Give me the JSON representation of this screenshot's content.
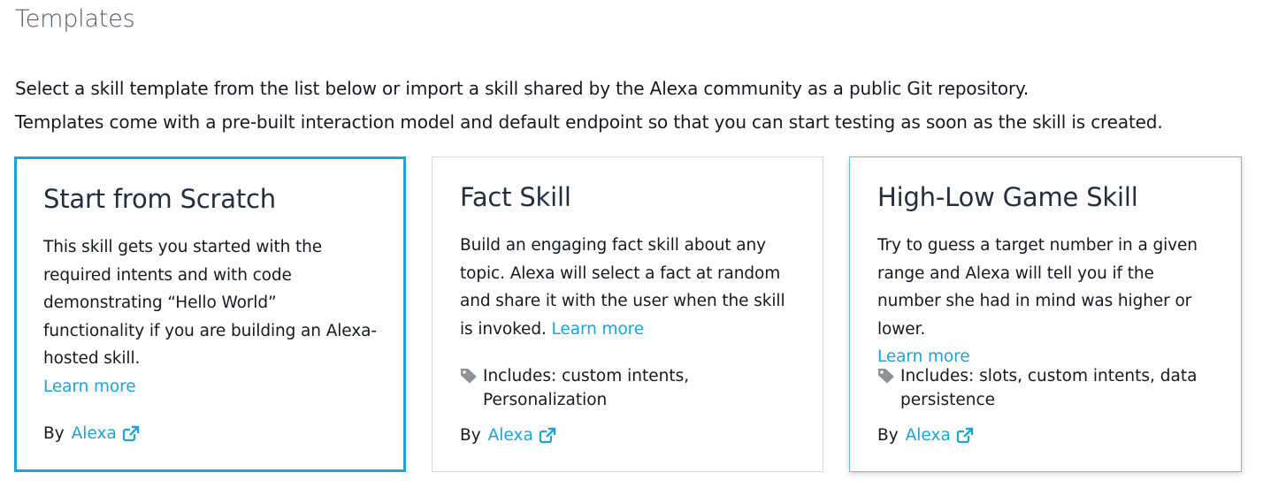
{
  "page": {
    "title": "Templates",
    "description_line1": "Select a skill template from the list below or import a skill shared by the Alexa community as a public Git repository.",
    "description_line2": "Templates come with a pre-built interaction model and default endpoint so that you can start testing as soon as the skill is created."
  },
  "cards": [
    {
      "title": "Start from Scratch",
      "body": "This skill gets you started with the required intents and with code demonstrating “Hello World” functionality if you are building an Alexa-hosted skill.",
      "learn_more": "Learn more",
      "includes": "",
      "by_label": "By",
      "author": "Alexa",
      "selected": true
    },
    {
      "title": "Fact Skill",
      "body": "Build an engaging fact skill about any topic. Alexa will select a fact at random and share it with the user when the skill is invoked.",
      "learn_more": "Learn more",
      "includes": "Includes: custom intents, Personalization",
      "by_label": "By",
      "author": "Alexa",
      "selected": false
    },
    {
      "title": "High-Low Game Skill",
      "body": "Try to guess a target number in a given range and Alexa will tell you if the number she had in mind was higher or lower.",
      "learn_more": "Learn more",
      "includes": "Includes: slots, custom intents, data persistence",
      "by_label": "By",
      "author": "Alexa",
      "selected": false
    }
  ],
  "icons": {
    "tag": "tag-icon",
    "external_link": "external-link-icon"
  },
  "colors": {
    "link": "#1ba4d8",
    "selected_border": "#1ba4d8",
    "hover_border": "#5bc8dd",
    "card_border": "#d5dbdb",
    "tag_icon": "#8d9396"
  }
}
